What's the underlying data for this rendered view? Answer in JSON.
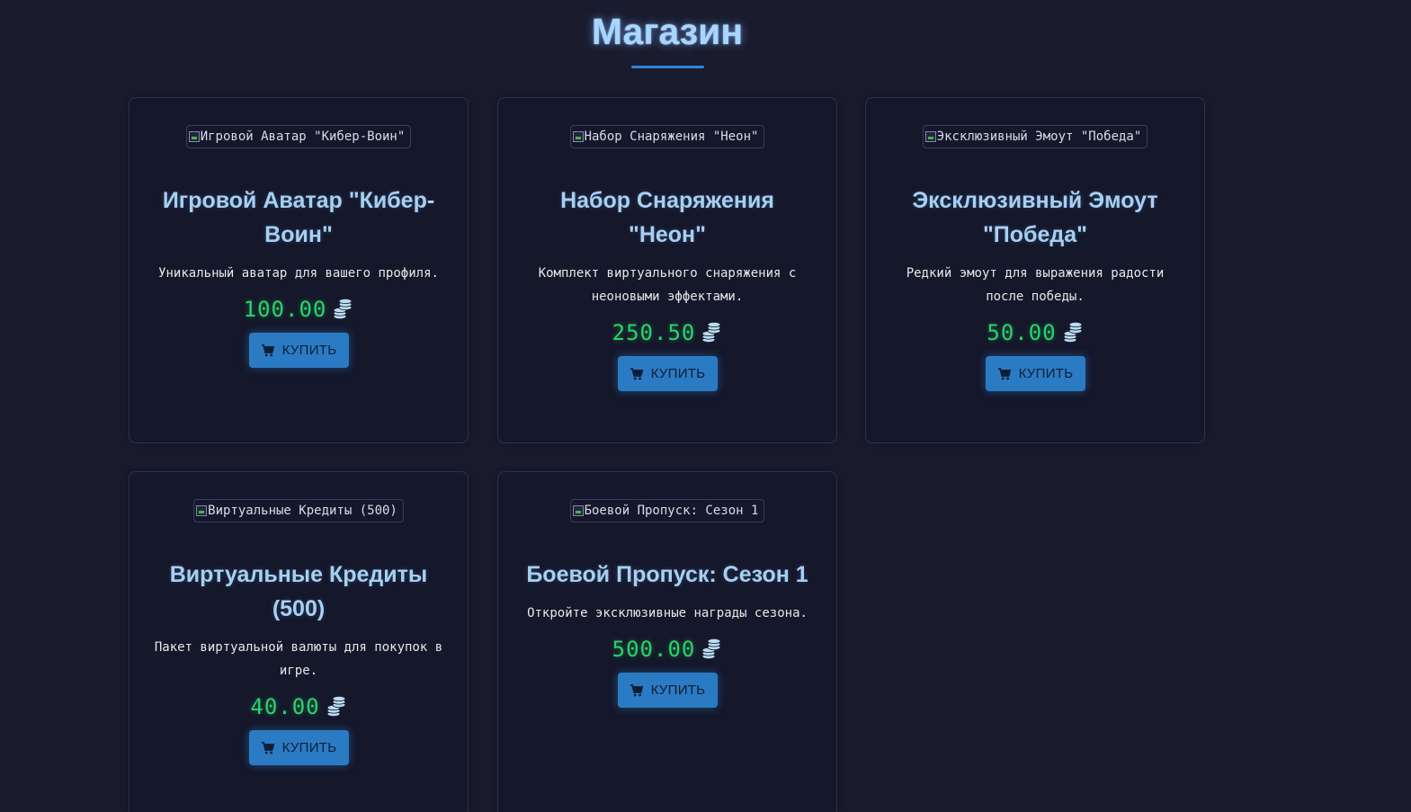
{
  "page": {
    "title": "Магазин"
  },
  "colors": {
    "background": "#1a1c2e",
    "card": "#15172a",
    "accent": "#2a7bc4",
    "title": "#a9d6ff",
    "price": "#2bd16a"
  },
  "icons": {
    "price": "coins-icon",
    "buy": "cart-icon",
    "image": "broken-image-icon"
  },
  "products": [
    {
      "image_alt": "Игровой Аватар \"Кибер-Воин\"",
      "title": "Игровой Аватар \"Кибер-Воин\"",
      "description": "Уникальный аватар для вашего профиля.",
      "price": "100.00",
      "buy_label": "КУПИТЬ"
    },
    {
      "image_alt": "Набор Снаряжения \"Неон\"",
      "title": "Набор Снаряжения \"Неон\"",
      "description": "Комплект виртуального снаряжения с неоновыми эффектами.",
      "price": "250.50",
      "buy_label": "КУПИТЬ"
    },
    {
      "image_alt": "Эксклюзивный Эмоут \"Победа\"",
      "title": "Эксклюзивный Эмоут \"Победа\"",
      "description": "Редкий эмоут для выражения радости после победы.",
      "price": "50.00",
      "buy_label": "КУПИТЬ"
    },
    {
      "image_alt": "Виртуальные Кредиты (500)",
      "title": "Виртуальные Кредиты (500)",
      "description": "Пакет виртуальной валюты для покупок в игре.",
      "price": "40.00",
      "buy_label": "КУПИТЬ"
    },
    {
      "image_alt": "Боевой Пропуск: Сезон 1",
      "title": "Боевой Пропуск: Сезон 1",
      "description": "Откройте эксклюзивные награды сезона.",
      "price": "500.00",
      "buy_label": "КУПИТЬ"
    }
  ]
}
